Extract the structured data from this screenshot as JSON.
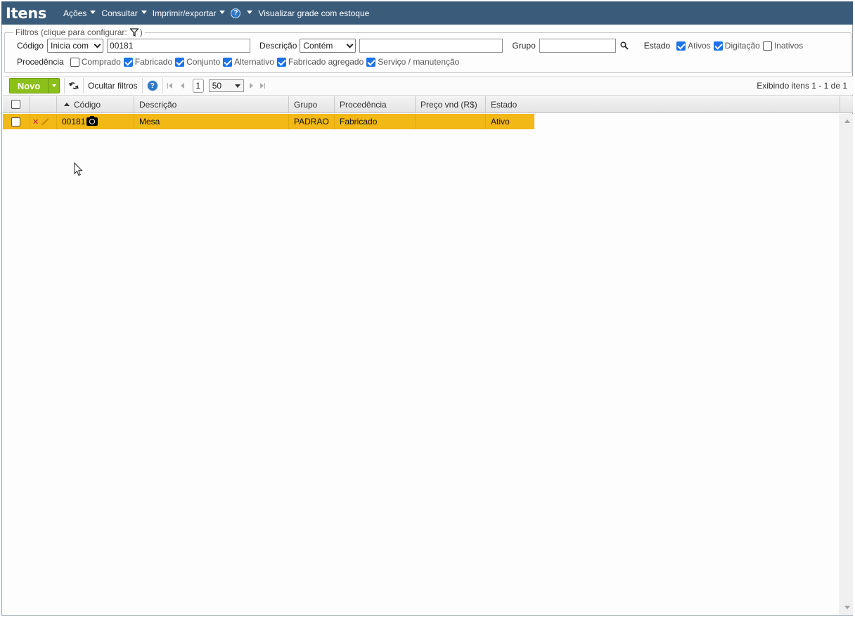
{
  "header": {
    "title": "Itens",
    "menus": [
      "Ações",
      "Consultar",
      "Imprimir/exportar"
    ],
    "help_glyph": "?",
    "view_grid_stock": "Visualizar grade com estoque"
  },
  "filters": {
    "legend": "Filtros (clique para configurar:",
    "legend_close": ")",
    "codigo_label": "Código",
    "codigo_mode": "Inicia com",
    "codigo_value": "00181",
    "descricao_label": "Descrição",
    "descricao_mode": "Contém",
    "descricao_value": "",
    "grupo_label": "Grupo",
    "grupo_value": "",
    "estado_label": "Estado",
    "estado_options": [
      {
        "label": "Ativos",
        "checked": true
      },
      {
        "label": "Digitação",
        "checked": true
      },
      {
        "label": "Inativos",
        "checked": false
      }
    ],
    "procedencia_label": "Procedência",
    "procedencia_options": [
      {
        "label": "Comprado",
        "checked": false
      },
      {
        "label": "Fabricado",
        "checked": true
      },
      {
        "label": "Conjunto",
        "checked": true
      },
      {
        "label": "Alternativo",
        "checked": true
      },
      {
        "label": "Fabricado agregado",
        "checked": true
      },
      {
        "label": "Serviço / manutenção",
        "checked": true
      }
    ]
  },
  "toolbar": {
    "novo_label": "Novo",
    "hide_filters_label": "Ocultar filtros",
    "current_page": "1",
    "page_size": "50",
    "showing_text": "Exibindo itens 1 - 1 de 1"
  },
  "grid": {
    "columns": [
      "Código",
      "Descrição",
      "Grupo",
      "Procedência",
      "Preço vnd (R$)",
      "Estado"
    ],
    "rows": [
      {
        "codigo": "00181",
        "descricao": "Mesa",
        "grupo": "PADRAO",
        "procedencia": "Fabricado",
        "preco": "",
        "estado": "Ativo"
      }
    ]
  },
  "colors": {
    "header_bg": "#3a5b79",
    "selected_row": "#f2b816",
    "novo_button": "#8bbf1a",
    "checkbox_checked": "#1a73e8"
  },
  "icons": {
    "filter": "funnel-icon",
    "search": "magnifier-icon",
    "refresh": "refresh-icon",
    "help": "help-icon",
    "delete": "x-icon",
    "edit": "pencil-icon",
    "photo": "camera-icon"
  }
}
